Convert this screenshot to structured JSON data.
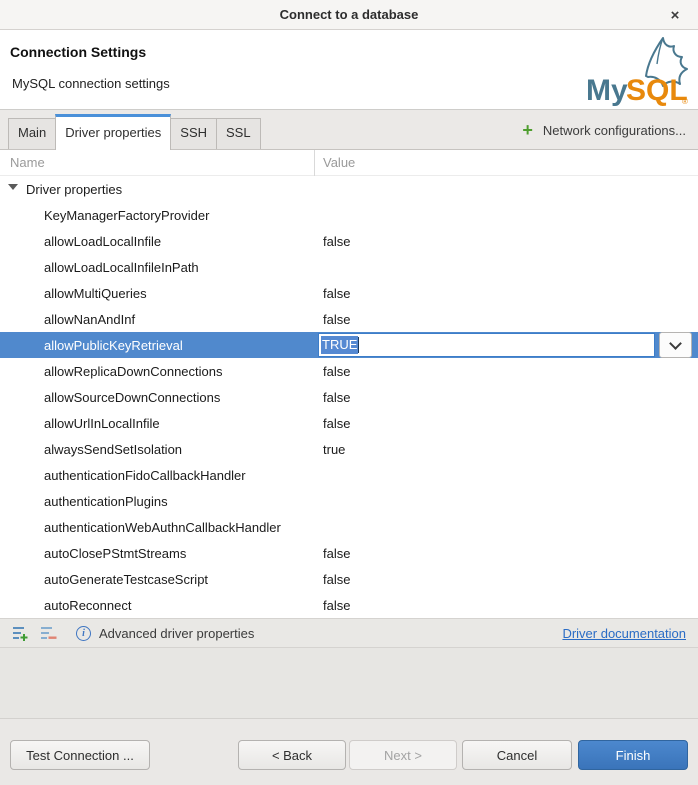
{
  "window": {
    "title": "Connect to a database",
    "close_glyph": "×"
  },
  "header": {
    "title": "Connection Settings",
    "subtitle": "MySQL connection settings",
    "logo": {
      "my": "My",
      "sql": "SQL",
      "reg": "®"
    }
  },
  "tabs": [
    {
      "label": "Main",
      "active": false
    },
    {
      "label": "Driver properties",
      "active": true
    },
    {
      "label": "SSH",
      "active": false
    },
    {
      "label": "SSL",
      "active": false
    }
  ],
  "network_config": {
    "plus_glyph": "+",
    "label": "Network configurations..."
  },
  "table": {
    "columns": {
      "name": "Name",
      "value": "Value"
    },
    "group_label": "Driver properties",
    "rows": [
      {
        "name": "KeyManagerFactoryProvider",
        "value": ""
      },
      {
        "name": "allowLoadLocalInfile",
        "value": "false"
      },
      {
        "name": "allowLoadLocalInfileInPath",
        "value": ""
      },
      {
        "name": "allowMultiQueries",
        "value": "false"
      },
      {
        "name": "allowNanAndInf",
        "value": "false"
      },
      {
        "name": "allowPublicKeyRetrieval",
        "value": "TRUE",
        "selected": true,
        "editing": true
      },
      {
        "name": "allowReplicaDownConnections",
        "value": "false"
      },
      {
        "name": "allowSourceDownConnections",
        "value": "false"
      },
      {
        "name": "allowUrlInLocalInfile",
        "value": "false"
      },
      {
        "name": "alwaysSendSetIsolation",
        "value": "true"
      },
      {
        "name": "authenticationFidoCallbackHandler",
        "value": ""
      },
      {
        "name": "authenticationPlugins",
        "value": ""
      },
      {
        "name": "authenticationWebAuthnCallbackHandler",
        "value": ""
      },
      {
        "name": "autoClosePStmtStreams",
        "value": "false"
      },
      {
        "name": "autoGenerateTestcaseScript",
        "value": "false"
      },
      {
        "name": "autoReconnect",
        "value": "false"
      }
    ]
  },
  "toolbar": {
    "info_label": "Advanced driver properties",
    "info_glyph": "i",
    "link_label": "Driver documentation"
  },
  "footer": {
    "test_label": "Test Connection ...",
    "back_label": "< Back",
    "next_label": "Next >",
    "cancel_label": "Cancel",
    "finish_label": "Finish"
  },
  "colors": {
    "accent_blue": "#4a90d9",
    "selection_blue": "#5089cd",
    "link_blue": "#2a6cc5",
    "finish_blue": "#3a74ba",
    "logo_teal": "#49788f",
    "logo_orange": "#e8890c",
    "plus_green": "#4f9e2f",
    "minus_salmon": "#e08473"
  }
}
